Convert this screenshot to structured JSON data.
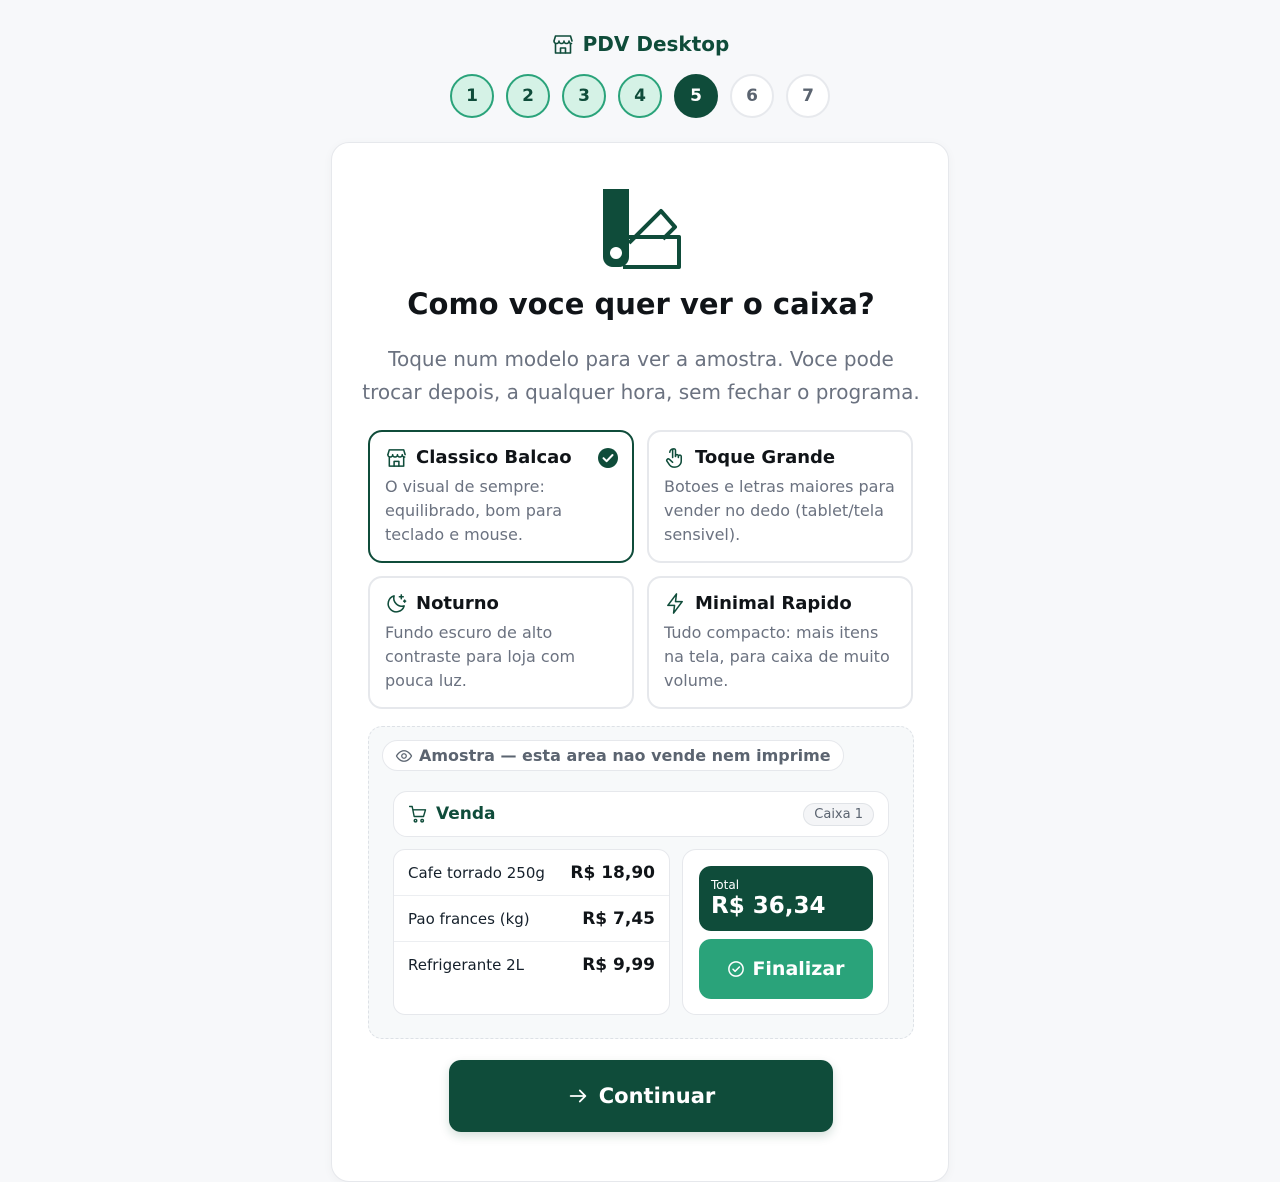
{
  "app": {
    "title": "PDV Desktop"
  },
  "steps": [
    {
      "label": "1",
      "state": "done"
    },
    {
      "label": "2",
      "state": "done"
    },
    {
      "label": "3",
      "state": "done"
    },
    {
      "label": "4",
      "state": "done"
    },
    {
      "label": "5",
      "state": "active"
    },
    {
      "label": "6",
      "state": "todo"
    },
    {
      "label": "7",
      "state": "todo"
    }
  ],
  "main": {
    "title": "Como voce quer ver o caixa?",
    "subtitle": "Toque num modelo para ver a amostra. Voce pode trocar depois, a qualquer hora, sem fechar o programa."
  },
  "options": [
    {
      "title": "Classico Balcao",
      "desc": "O visual de sempre: equilibrado, bom para teclado e mouse.",
      "icon": "store-icon",
      "selected": true
    },
    {
      "title": "Toque Grande",
      "desc": "Botoes e letras maiores para vender no dedo (tablet/tela sensivel).",
      "icon": "hand-pointer-icon",
      "selected": false
    },
    {
      "title": "Noturno",
      "desc": "Fundo escuro de alto contraste para loja com pouca luz.",
      "icon": "moon-stars-icon",
      "selected": false
    },
    {
      "title": "Minimal Rapido",
      "desc": "Tudo compacto: mais itens na tela, para caixa de muito volume.",
      "icon": "lightning-icon",
      "selected": false
    }
  ],
  "preview": {
    "badge": "Amostra — esta area nao vende nem imprime",
    "venda_label": "Venda",
    "caixa_label": "Caixa 1",
    "items": [
      {
        "name": "Cafe torrado 250g",
        "price": "R$ 18,90"
      },
      {
        "name": "Pao frances (kg)",
        "price": "R$ 7,45"
      },
      {
        "name": "Refrigerante 2L",
        "price": "R$ 9,99"
      }
    ],
    "total_label": "Total",
    "total_value": "R$ 36,34",
    "finalizar_label": "Finalizar"
  },
  "continue_label": "Continuar",
  "colors": {
    "primary": "#0f4c3a",
    "accent": "#2aa37a",
    "step_done_bg": "#d5f2e6"
  }
}
